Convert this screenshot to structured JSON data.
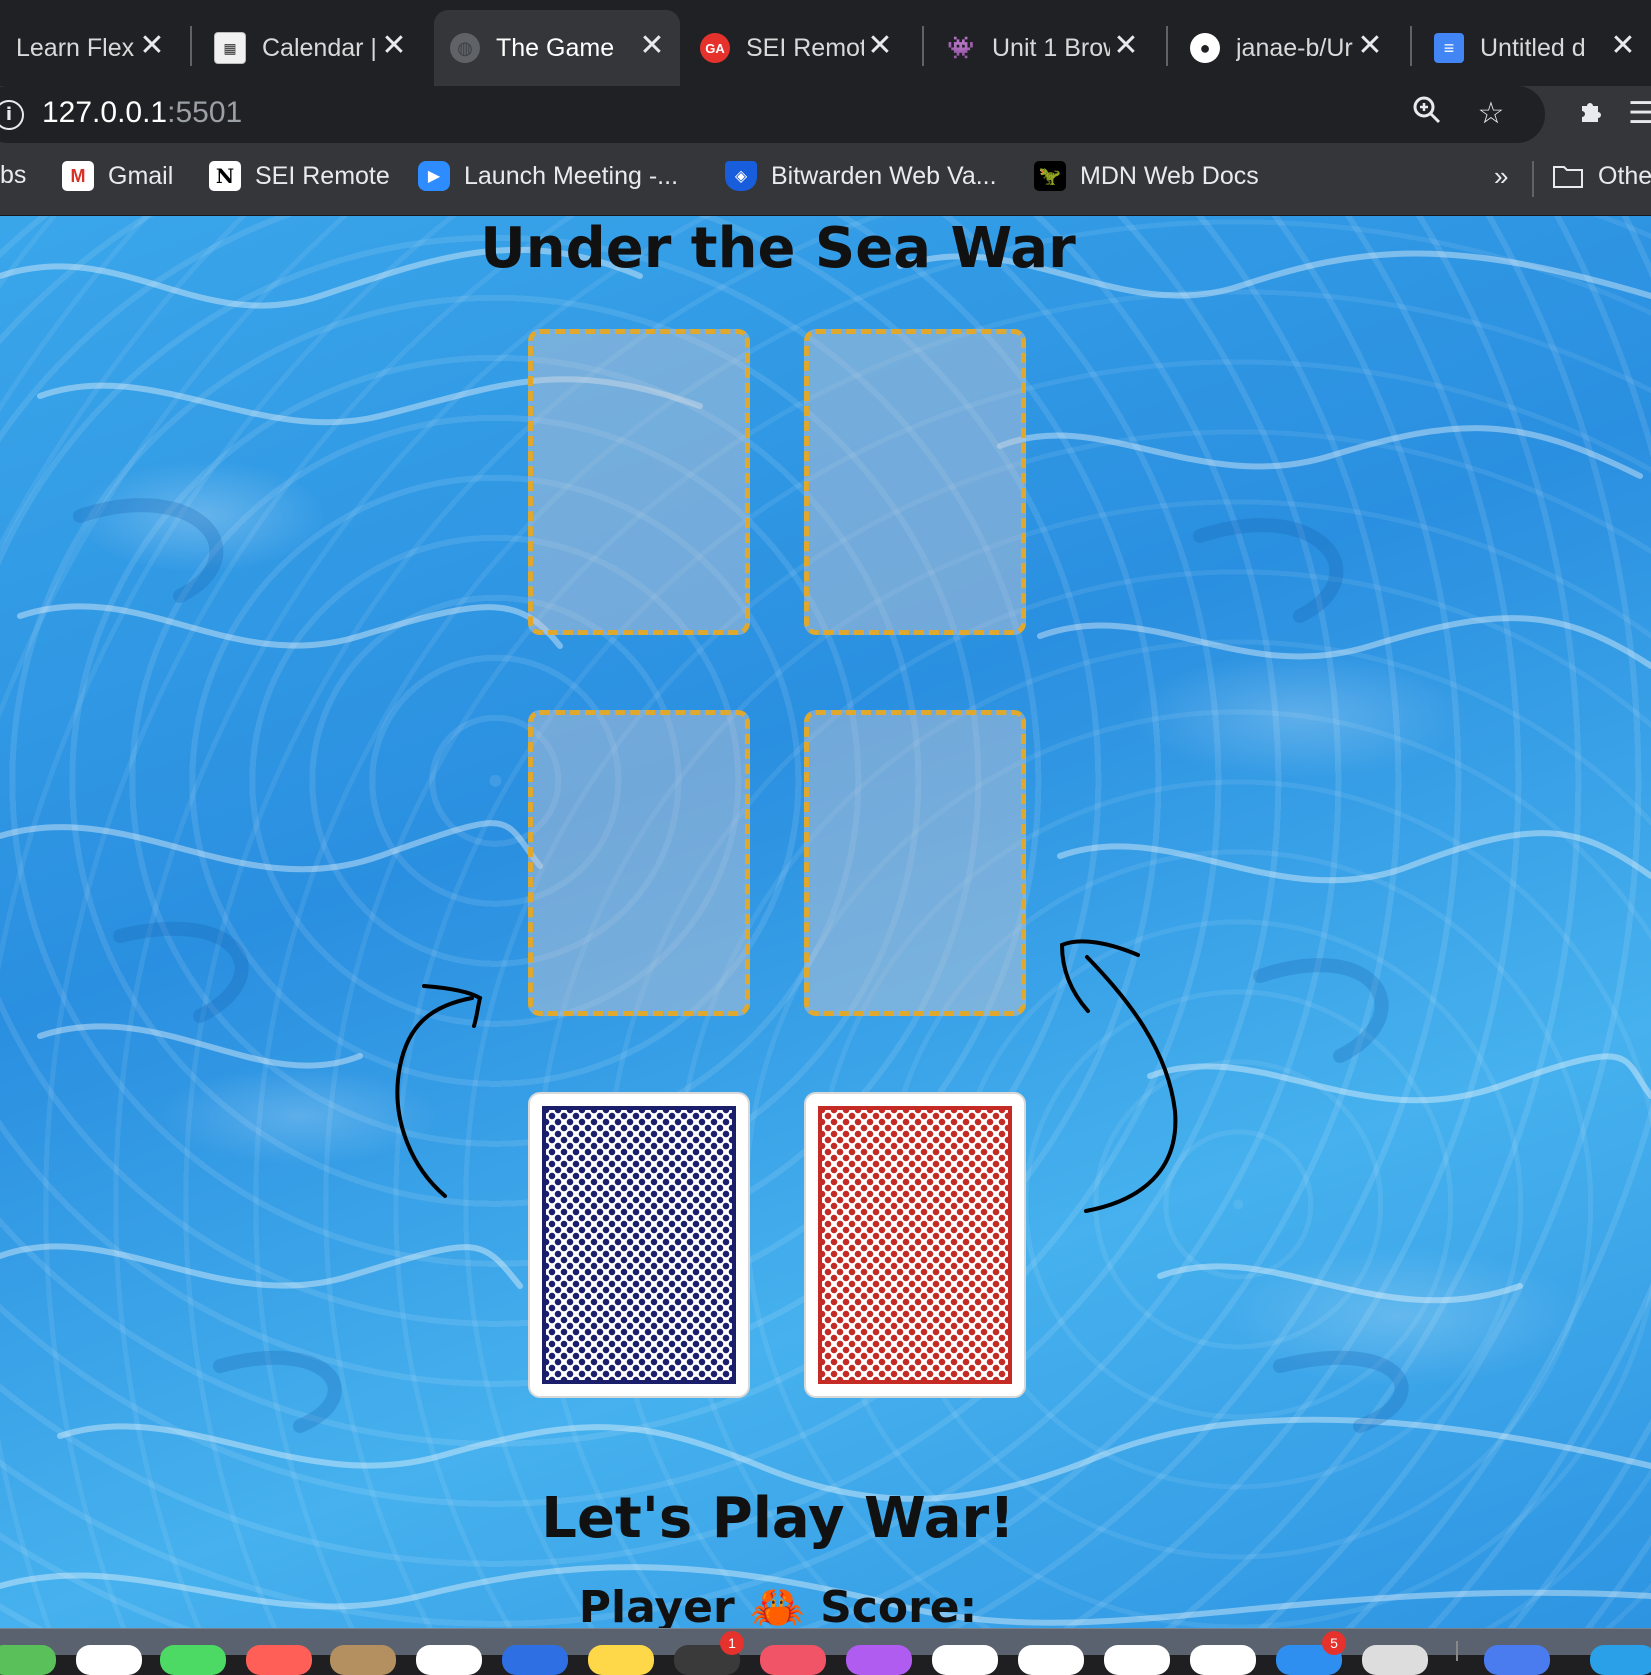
{
  "browser": {
    "tabs": [
      {
        "title": "Learn Flex",
        "favicon": "flex-icon",
        "active": false
      },
      {
        "title": "Calendar |",
        "favicon": "calendar-icon",
        "active": false
      },
      {
        "title": "The Game",
        "favicon": "globe-icon",
        "active": true
      },
      {
        "title": "SEI Remot",
        "favicon": "ga-icon",
        "active": false
      },
      {
        "title": "Unit 1 Brow",
        "favicon": "space-invader-icon",
        "active": false
      },
      {
        "title": "janae-b/Ur",
        "favicon": "github-icon",
        "active": false
      },
      {
        "title": "Untitled d",
        "favicon": "docs-icon",
        "active": false
      }
    ],
    "close_glyph": "✕",
    "url_host": "127.0.0.1",
    "url_port": ":5501",
    "bookmarks": [
      {
        "label": "bs"
      },
      {
        "label": "Gmail",
        "icon": "gmail-icon"
      },
      {
        "label": "SEI Remote",
        "icon": "notion-icon"
      },
      {
        "label": "Launch Meeting -...",
        "icon": "zoom-icon"
      },
      {
        "label": "Bitwarden Web Va...",
        "icon": "bitwarden-icon"
      },
      {
        "label": "MDN Web Docs",
        "icon": "mdn-icon"
      }
    ],
    "overflow_glyph": "»",
    "other_bookmarks": "Othe"
  },
  "game": {
    "title": "Under the Sea War",
    "play_message": "Let's Play War!",
    "score_label": "Player 🦀 Score:",
    "slot_border_color": "#e0a92e",
    "player_deck_color": "#1b1f6b",
    "computer_deck_color": "#c42b25"
  },
  "dock": {
    "badges": [
      "1",
      "5"
    ]
  }
}
